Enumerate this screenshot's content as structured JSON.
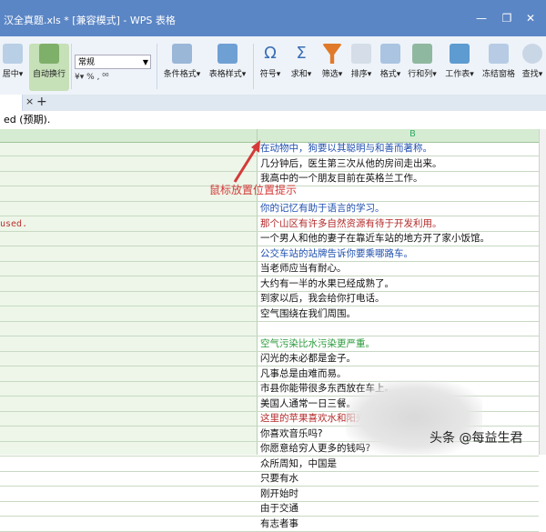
{
  "window": {
    "title": "汉全真题.xls * [兼容模式] - WPS 表格",
    "min": "—",
    "max": "❐",
    "close": "✕"
  },
  "ribbon": {
    "buttons": [
      "居中▾",
      "自动换行",
      "条件格式▾",
      "表格样式▾",
      "符号▾",
      "求和▾",
      "筛选▾",
      "排序▾",
      "格式▾",
      "行和列▾",
      "工作表▾",
      "冻结窗格",
      "查找▾"
    ],
    "number_format": "常规",
    "number_tools": "¥▾  %  ‚  ⁰⁰"
  },
  "tabbar": {
    "close": "×",
    "add": "+"
  },
  "formula_bar": {
    "text": "ed (预期)."
  },
  "grid": {
    "column_b": "B",
    "col_a_text": " used.",
    "rows": [
      {
        "text": "在动物中，狗要以其聪明与和善而著称。",
        "color": "blue"
      },
      {
        "text": "几分钟后，医生第三次从他的房间走出来。",
        "color": "black"
      },
      {
        "text": "我高中的一个朋友目前在英格兰工作。",
        "color": "black"
      },
      {
        "text": "",
        "color": "black"
      },
      {
        "text": "你的记忆有助于语言的学习。",
        "color": "blue"
      },
      {
        "text": "那个山区有许多自然资源有待于开发利用。",
        "color": "red"
      },
      {
        "text": "一个男人和他的妻子在靠近车站的地方开了家小饭馆。",
        "color": "black"
      },
      {
        "text": "公交车站的站牌告诉你要乘哪路车。",
        "color": "blue"
      },
      {
        "text": "当老师应当有耐心。",
        "color": "black"
      },
      {
        "text": "大约有一半的水果已经成熟了。",
        "color": "black"
      },
      {
        "text": "到家以后，我会给你打电话。",
        "color": "black"
      },
      {
        "text": "空气围绕在我们周围。",
        "color": "black"
      },
      {
        "text": "",
        "color": "black"
      },
      {
        "text": "空气污染比水污染更严重。",
        "color": "green"
      },
      {
        "text": "闪光的未必都是金子。",
        "color": "black"
      },
      {
        "text": "凡事总是由难而易。",
        "color": "black"
      },
      {
        "text": "市县你能带很多东西放在车上。",
        "color": "black"
      },
      {
        "text": "美国人通常一日三餐。",
        "color": "black"
      },
      {
        "text": "这里的苹果喜欢水和阳光。",
        "color": "red"
      },
      {
        "text": "你喜欢音乐吗?",
        "color": "black"
      },
      {
        "text": "你愿意给穷人更多的钱吗?",
        "color": "black"
      },
      {
        "text": "众所周知，中国是",
        "color": "black"
      },
      {
        "text": "只要有水",
        "color": "black"
      },
      {
        "text": "刚开始时",
        "color": "black"
      },
      {
        "text": "由于交通",
        "color": "black"
      },
      {
        "text": "有志者事",
        "color": "black"
      }
    ]
  },
  "annotation": {
    "text": "鼠标放置位置提示"
  },
  "watermark": {
    "text": "头条 @每益生君"
  }
}
